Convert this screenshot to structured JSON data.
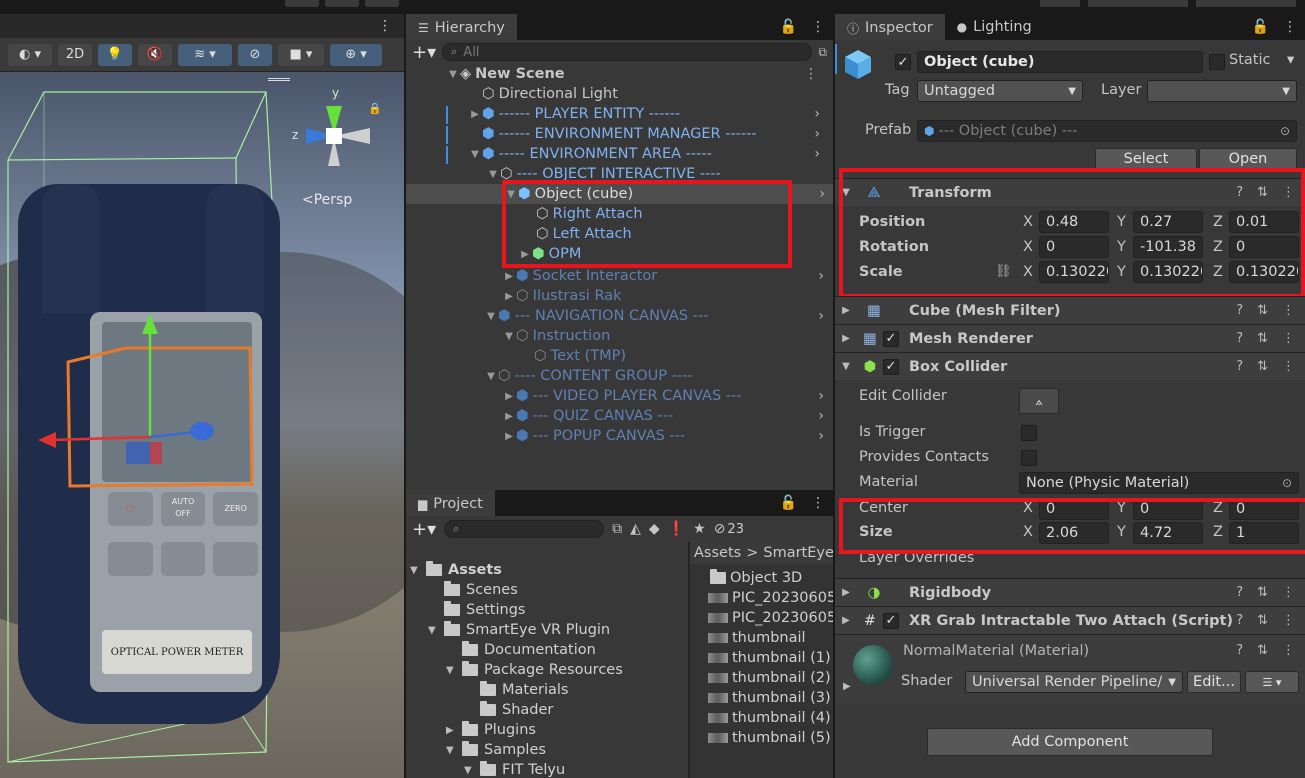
{
  "colors": {
    "accent": "#46607c",
    "highlight": "#e8141e",
    "blue_text": "#7fb2f0"
  },
  "scene": {
    "toolbar": {
      "mode_2d": "2D",
      "persp_label": "<Persp",
      "gizmo_axes": {
        "y": "y",
        "z": "z"
      }
    },
    "device_labels": {
      "meter_text": "OPTICAL POWER METER",
      "auto_off": "AUTO\nOFF",
      "zero": "ZERO"
    }
  },
  "hierarchy": {
    "tab_label": "Hierarchy",
    "search_placeholder": "All",
    "rows": [
      {
        "label": "New Scene"
      },
      {
        "label": "Directional Light"
      },
      {
        "label": "------  PLAYER ENTITY ------"
      },
      {
        "label": "------ ENVIRONMENT MANAGER ------"
      },
      {
        "label": "----- ENVIRONMENT AREA -----"
      },
      {
        "label": "---- OBJECT INTERACTIVE ----"
      },
      {
        "label": "Object (cube)"
      },
      {
        "label": "Right Attach"
      },
      {
        "label": "Left Attach"
      },
      {
        "label": "OPM"
      },
      {
        "label": "Socket Interactor"
      },
      {
        "label": "Ilustrasi Rak"
      },
      {
        "label": "--- NAVIGATION CANVAS ---"
      },
      {
        "label": "Instruction"
      },
      {
        "label": "Text (TMP)"
      },
      {
        "label": "---- CONTENT GROUP ----"
      },
      {
        "label": "--- VIDEO PLAYER CANVAS ---"
      },
      {
        "label": "--- QUIZ CANVAS ---"
      },
      {
        "label": "--- POPUP CANVAS ---"
      }
    ]
  },
  "project": {
    "tab_label": "Project",
    "hidden_count": "23",
    "breadcrumb": {
      "root": "Assets",
      "sep": ">",
      "current": "SmartEye"
    },
    "tree": [
      {
        "label": "Assets"
      },
      {
        "label": "Scenes"
      },
      {
        "label": "Settings"
      },
      {
        "label": "SmartEye VR Plugin"
      },
      {
        "label": "Documentation"
      },
      {
        "label": "Package Resources"
      },
      {
        "label": "Materials"
      },
      {
        "label": "Shader"
      },
      {
        "label": "Plugins"
      },
      {
        "label": "Samples"
      },
      {
        "label": "FIT Telyu"
      }
    ],
    "files": [
      {
        "label": "Object 3D"
      },
      {
        "label": "PIC_20230605"
      },
      {
        "label": "PIC_20230605"
      },
      {
        "label": "thumbnail"
      },
      {
        "label": "thumbnail (1)"
      },
      {
        "label": "thumbnail (2)"
      },
      {
        "label": "thumbnail (3)"
      },
      {
        "label": "thumbnail (4)"
      },
      {
        "label": "thumbnail (5)"
      }
    ]
  },
  "inspector": {
    "tab_inspector": "Inspector",
    "tab_lighting": "Lighting",
    "object_name": "Object (cube)",
    "static_label": "Static",
    "tag_label": "Tag",
    "tag_value": "Untagged",
    "layer_label": "Layer",
    "layer_value": "",
    "prefab_label": "Prefab",
    "prefab_value": "--- Object (cube) ---",
    "select_btn": "Select",
    "open_btn": "Open",
    "transform": {
      "title": "Transform",
      "position_label": "Position",
      "rotation_label": "Rotation",
      "scale_label": "Scale",
      "axis_x": "X",
      "axis_y": "Y",
      "axis_z": "Z",
      "position": {
        "x": "0.48",
        "y": "0.27",
        "z": "0.01"
      },
      "rotation": {
        "x": "0",
        "y": "-101.38",
        "z": "0"
      },
      "scale": {
        "x": "0.130220",
        "y": "0.130220",
        "z": "0.130220"
      }
    },
    "mesh_filter": {
      "title": "Cube (Mesh Filter)"
    },
    "mesh_renderer": {
      "title": "Mesh Renderer"
    },
    "box_collider": {
      "title": "Box Collider",
      "edit_collider": "Edit Collider",
      "is_trigger": "Is Trigger",
      "provides_contacts": "Provides Contacts",
      "material_label": "Material",
      "material_value": "None (Physic Material)",
      "center_label": "Center",
      "center": {
        "x": "0",
        "y": "0",
        "z": "0"
      },
      "size_label": "Size",
      "size": {
        "x": "2.06",
        "y": "4.72",
        "z": "1"
      },
      "layer_overrides": "Layer Overrides"
    },
    "rigidbody": {
      "title": "Rigidbody"
    },
    "xr_grab": {
      "title": "XR Grab Intractable Two Attach (Script)"
    },
    "material": {
      "name": "NormalMaterial (Material)",
      "shader_label": "Shader",
      "shader_value": "Universal Render Pipeline/",
      "edit_btn": "Edit..."
    },
    "add_component": "Add Component"
  }
}
